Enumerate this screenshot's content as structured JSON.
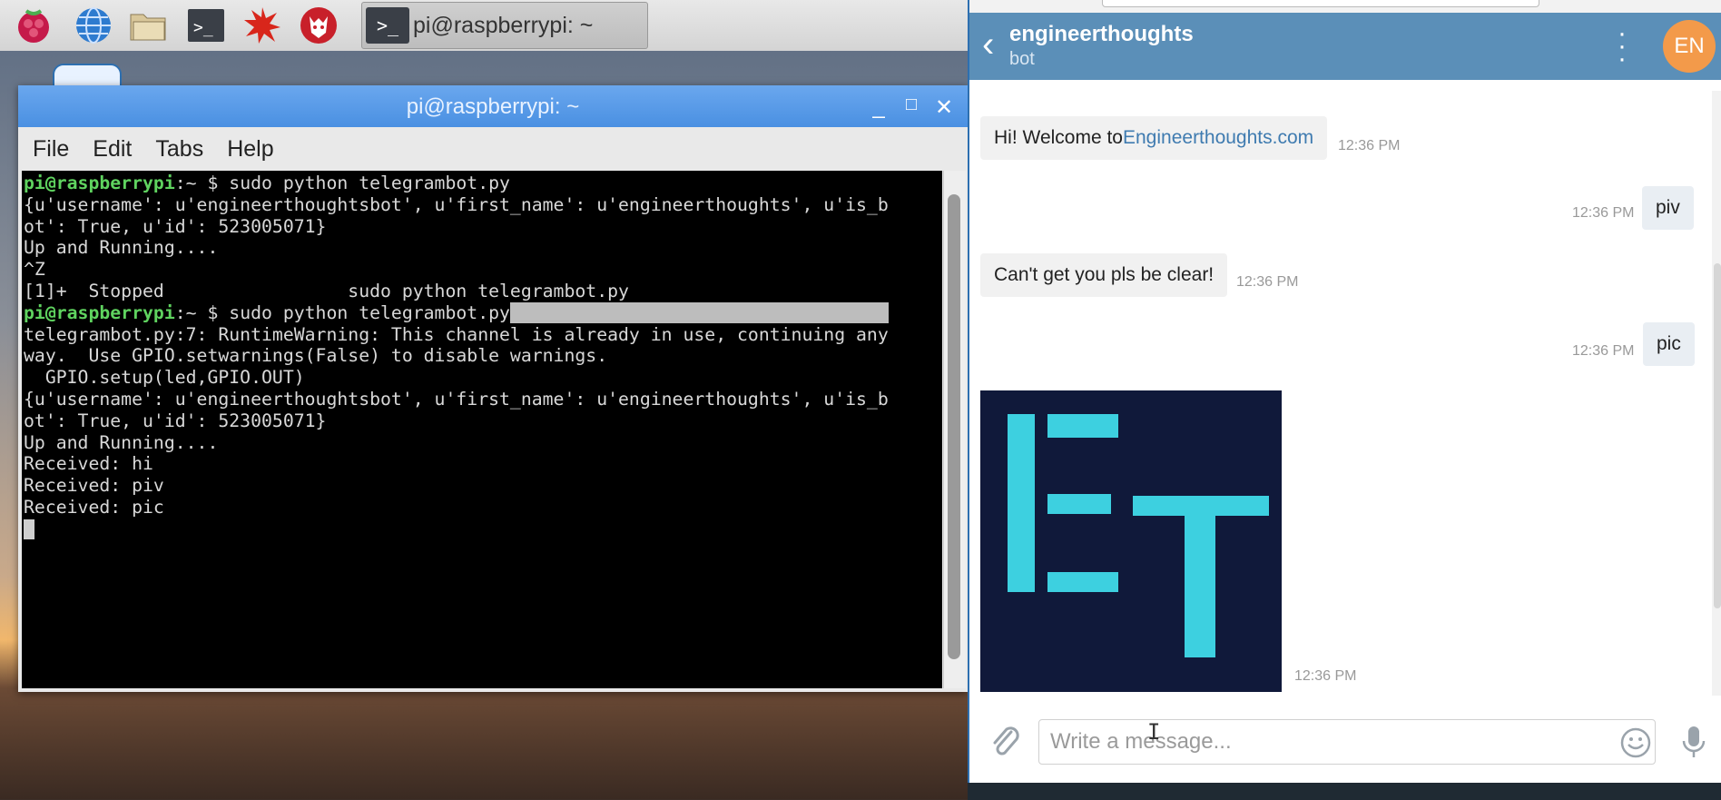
{
  "taskbar": {
    "icons": [
      "raspberry-icon",
      "globe-icon",
      "folder-icon",
      "terminal-icon",
      "starburst-icon",
      "wolf-icon"
    ],
    "task": {
      "icon": ">_",
      "label": "pi@raspberrypi: ~"
    }
  },
  "terminal": {
    "title": "pi@raspberrypi: ~",
    "buttons": {
      "minimize": "_",
      "maximize": "□",
      "close": "✕"
    },
    "menu": [
      "File",
      "Edit",
      "Tabs",
      "Help"
    ],
    "prompt": "pi@raspberrypi",
    "prompt_rest": ":~ $ ",
    "lines": [
      "{u'username': u'engineerthoughtsbot', u'first_name': u'engineerthoughts', u'is_b",
      "ot': True, u'id': 523005071}",
      "Up and Running....",
      "^Z",
      "[1]+  Stopped                 sudo python telegrambot.py",
      "telegrambot.py:7: RuntimeWarning: This channel is already in use, continuing any",
      "way.  Use GPIO.setwarnings(False) to disable warnings.",
      "  GPIO.setup(led,GPIO.OUT)",
      "{u'username': u'engineerthoughtsbot', u'first_name': u'engineerthoughts', u'is_b",
      "ot': True, u'id': 523005071}",
      "Up and Running....",
      "Received: hi",
      "Received: piv",
      "Received: pic"
    ],
    "command1": "sudo python telegrambot.py",
    "command2": "sudo python telegrambot.py"
  },
  "telegram": {
    "chat_name": "engineerthoughts",
    "chat_status": "bot",
    "avatar_initials": "EN",
    "messages": [
      {
        "dir": "in",
        "text_prefix": "Hi! Welcome to ",
        "link": "Engineerthoughts.com",
        "time": "12:36 PM"
      },
      {
        "dir": "out",
        "text": "piv",
        "time": "12:36 PM"
      },
      {
        "dir": "in",
        "text": "Can't get you pls be clear!",
        "time": "12:36 PM"
      },
      {
        "dir": "out",
        "text": "pic",
        "time": "12:36 PM"
      },
      {
        "dir": "in",
        "image": "ET",
        "time": "12:36 PM"
      }
    ],
    "input_placeholder": "Write a message..."
  },
  "colors": {
    "accent": "#5b8fb8",
    "image_bg": "#10193a",
    "image_fg": "#3dd0e0",
    "prompt": "#5fd35f"
  }
}
